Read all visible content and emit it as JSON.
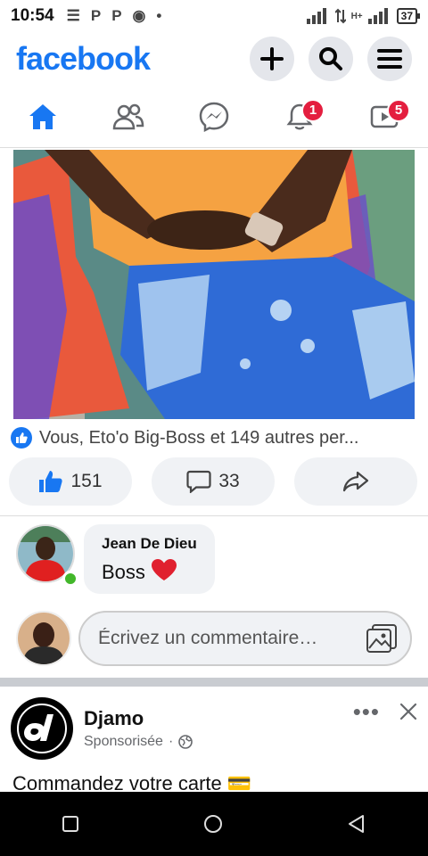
{
  "status_bar": {
    "time": "10:54",
    "left_icons": [
      "☰",
      "P",
      "P",
      "◉",
      "•"
    ],
    "network": "H+",
    "battery": "37"
  },
  "header": {
    "logo": "facebook",
    "actions": [
      "plus-icon",
      "search-icon",
      "menu-icon"
    ]
  },
  "nav": {
    "tabs": [
      {
        "name": "home",
        "icon": "home-icon",
        "badge": ""
      },
      {
        "name": "friends",
        "icon": "friends-icon",
        "badge": ""
      },
      {
        "name": "messenger",
        "icon": "messenger-icon",
        "badge": ""
      },
      {
        "name": "notifications",
        "icon": "bell-icon",
        "badge": "1"
      },
      {
        "name": "watch",
        "icon": "video-icon",
        "badge": "5"
      }
    ],
    "accent": "#1877f2"
  },
  "post": {
    "reactions_text": "Vous, Eto'o Big-Boss et 149 autres per...",
    "like_count": "151",
    "comment_count": "33"
  },
  "comment": {
    "author": "Jean De Dieu",
    "text": "Boss",
    "emoji": "❤️"
  },
  "write_comment": {
    "placeholder": "Écrivez un commentaire…"
  },
  "sponsored": {
    "name": "Djamo",
    "label": "Sponsorisée",
    "separator": "·",
    "text": "Commandez votre carte 💳"
  },
  "colors": {
    "brand": "#1877f2",
    "badge": "#e41e3f",
    "online": "#42b72a"
  }
}
